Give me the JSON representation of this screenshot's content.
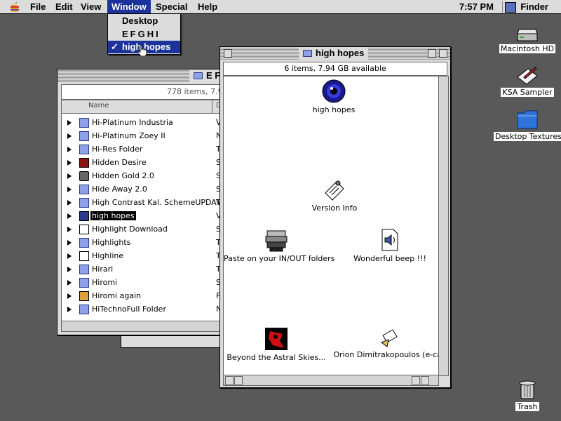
{
  "menubar": {
    "menus": [
      "File",
      "Edit",
      "View",
      "Window",
      "Special",
      "Help"
    ],
    "active_menu": "Window",
    "clock": "7:57 PM",
    "app": "Finder"
  },
  "window_menu": {
    "items": [
      "Desktop",
      "EFGHI",
      "high hopes"
    ],
    "checked_item": "high hopes",
    "check_glyph": "✓"
  },
  "list_window": {
    "title": "EFGHI",
    "title_visible": "E F",
    "status": "778 items, 7.9",
    "column_name": "Name",
    "column_kind": "D",
    "rows": [
      {
        "name": "Hi-Platinum Industria",
        "kind": "V",
        "icon": "folder-icon"
      },
      {
        "name": "Hi-Platinum Zoey II",
        "kind": "N",
        "icon": "folder-icon"
      },
      {
        "name": "Hi-Res Folder",
        "kind": "T",
        "icon": "folder-icon"
      },
      {
        "name": "Hidden Desire",
        "kind": "S",
        "icon": "book-icon"
      },
      {
        "name": "Hidden Gold 2.0",
        "kind": "S",
        "icon": "gold-icon"
      },
      {
        "name": "Hide Away 2.0",
        "kind": "S",
        "icon": "folder-icon"
      },
      {
        "name": "High Contrast Kal. SchemeUPDATE",
        "kind": "V",
        "icon": "folder-icon"
      },
      {
        "name": "high hopes",
        "kind": "V",
        "icon": "folder-dark-icon",
        "selected": true
      },
      {
        "name": "Highlight Download",
        "kind": "S",
        "icon": "n-logo-icon"
      },
      {
        "name": "Highlights",
        "kind": "T",
        "icon": "folder-icon"
      },
      {
        "name": "Highline",
        "kind": "T",
        "icon": "folder-outline-icon"
      },
      {
        "name": "Hirari",
        "kind": "T",
        "icon": "folder-icon"
      },
      {
        "name": "Hiromi",
        "kind": "S",
        "icon": "folder-icon"
      },
      {
        "name": "Hiromi again",
        "kind": "F",
        "icon": "photo-icon"
      },
      {
        "name": "HiTechnoFull Folder",
        "kind": "N",
        "icon": "folder-icon"
      }
    ]
  },
  "icon_window": {
    "title": "high hopes",
    "status": "6 items, 7.94 GB available",
    "items": [
      {
        "name": "high hopes",
        "icon": "blue-eye-icon"
      },
      {
        "name": "Version Info",
        "icon": "note-icon"
      },
      {
        "name": "Paste on your IN/OUT folders",
        "icon": "stack-icon"
      },
      {
        "name": "Wonderful beep !!!",
        "icon": "sound-file-icon"
      },
      {
        "name": "Beyond the Astral Skies...",
        "icon": "red-image-icon"
      },
      {
        "name": "Orion Dimitrakopoulos (e-card)",
        "icon": "letter-icon"
      }
    ],
    "visible_last_label": "Orion Dimitrakopoulos (e-car"
  },
  "desktop": {
    "icons": [
      {
        "name": "Macintosh HD",
        "icon": "hard-drive-icon"
      },
      {
        "name": "KSA Sampler",
        "icon": "disk-pen-icon"
      },
      {
        "name": "Desktop Textures",
        "icon": "blue-folder-icon"
      },
      {
        "name": "Trash",
        "icon": "trash-icon"
      }
    ]
  },
  "colors": {
    "desktop": "#595959",
    "menu_highlight": "#1c3399",
    "chrome": "#dcdcdc"
  }
}
